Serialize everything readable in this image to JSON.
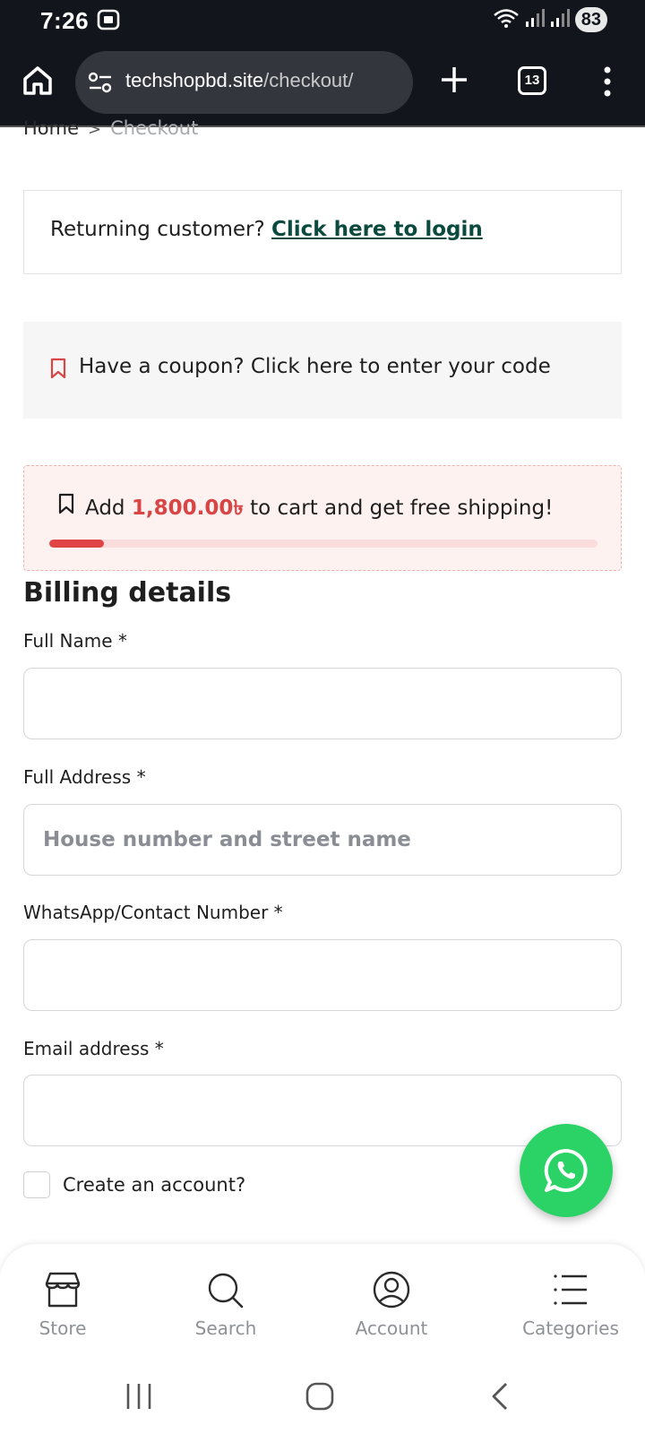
{
  "status_bar": {
    "time": "7:26",
    "battery": "83"
  },
  "browser": {
    "url_host": "techshopbd.site",
    "url_path": "/checkout/",
    "tab_count": "13"
  },
  "breadcrumb": {
    "home": "Home",
    "separator": ">",
    "current": "Checkout"
  },
  "login_notice": {
    "text": "Returning customer?",
    "link": "Click here to login"
  },
  "coupon_notice": {
    "text": "Have a coupon? Click here to enter your code"
  },
  "shipping_notice": {
    "prefix": "Add",
    "amount": "1,800.00৳",
    "suffix": "to cart and get free shipping!",
    "progress_percent": 10,
    "accent_color": "#e04545"
  },
  "billing": {
    "title": "Billing details",
    "fields": [
      {
        "label": "Full Name *",
        "value": "",
        "placeholder": ""
      },
      {
        "label": "Full Address  *",
        "value": "",
        "placeholder": "House number and street name"
      },
      {
        "label": "WhatsApp/Contact Number *",
        "value": "",
        "placeholder": ""
      },
      {
        "label": "Email address *",
        "value": "",
        "placeholder": ""
      }
    ],
    "create_account_label": "Create an account?"
  },
  "bottom_nav": {
    "items": [
      {
        "label": "Store",
        "icon": "store-icon"
      },
      {
        "label": "Search",
        "icon": "search-icon"
      },
      {
        "label": "Account",
        "icon": "account-icon"
      },
      {
        "label": "Categories",
        "icon": "categories-icon"
      }
    ]
  },
  "colors": {
    "whatsapp": "#2bd366",
    "link": "#0b4a3f",
    "status_bar": "#12151c"
  }
}
